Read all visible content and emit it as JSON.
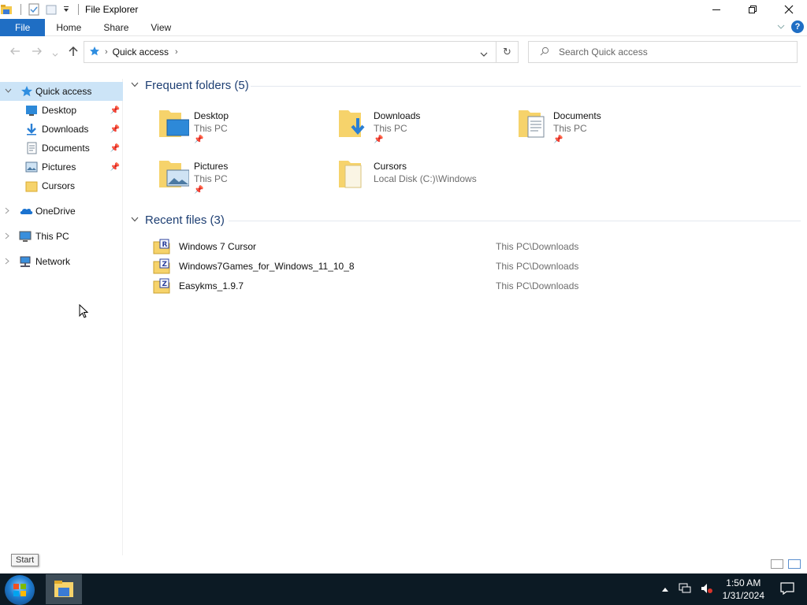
{
  "window": {
    "title": "File Explorer"
  },
  "ribbon": {
    "file": "File",
    "home": "Home",
    "share": "Share",
    "view": "View",
    "help": "?"
  },
  "address": {
    "path": "Quick access",
    "search_placeholder": "Search Quick access"
  },
  "sidebar": {
    "quick_access": "Quick access",
    "items": [
      {
        "label": "Desktop",
        "icon": "desktop-icon",
        "pinned": true
      },
      {
        "label": "Downloads",
        "icon": "downloads-icon",
        "pinned": true
      },
      {
        "label": "Documents",
        "icon": "documents-icon",
        "pinned": true
      },
      {
        "label": "Pictures",
        "icon": "pictures-icon",
        "pinned": true
      },
      {
        "label": "Cursors",
        "icon": "folder-icon",
        "pinned": false
      }
    ],
    "onedrive": "OneDrive",
    "thispc": "This PC",
    "network": "Network"
  },
  "frequent": {
    "header": "Frequent folders (5)",
    "folders": [
      {
        "name": "Desktop",
        "location": "This PC",
        "pinned": true
      },
      {
        "name": "Downloads",
        "location": "This PC",
        "pinned": true
      },
      {
        "name": "Documents",
        "location": "This PC",
        "pinned": true
      },
      {
        "name": "Pictures",
        "location": "This PC",
        "pinned": true
      },
      {
        "name": "Cursors",
        "location": "Local Disk (C:)\\Windows",
        "pinned": false
      }
    ]
  },
  "recent": {
    "header": "Recent files (3)",
    "files": [
      {
        "name": "Windows 7 Cursor",
        "path": "This PC\\Downloads",
        "badge": "R"
      },
      {
        "name": "Windows7Games_for_Windows_11_10_8",
        "path": "This PC\\Downloads",
        "badge": "Z"
      },
      {
        "name": "Easykms_1.9.7",
        "path": "This PC\\Downloads",
        "badge": "Z"
      }
    ]
  },
  "tooltip": {
    "text": "Start"
  },
  "taskbar": {
    "time": "1:50 AM",
    "date": "1/31/2024"
  }
}
